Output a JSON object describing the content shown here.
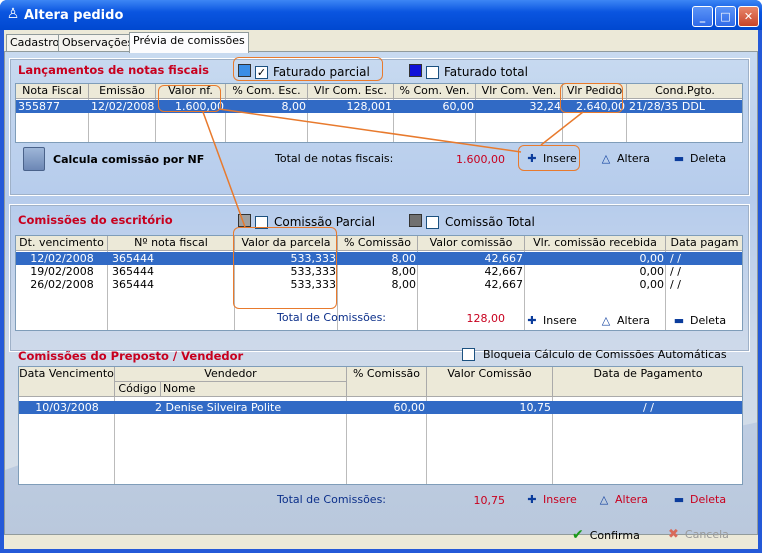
{
  "window": {
    "title": "Altera pedido",
    "min": "_",
    "max": "□",
    "close": "✕"
  },
  "tabs": [
    "Cadastro",
    "Observações",
    "Prévia de comissões"
  ],
  "nf": {
    "title": "Lançamentos de notas fiscais",
    "chk_parcial": "Faturado parcial",
    "chk_total": "Faturado total",
    "headers": [
      "Nota Fiscal",
      "Emissão",
      "Valor nf.",
      "% Com. Esc.",
      "Vlr Com. Esc.",
      "% Com. Ven.",
      "Vlr Com. Ven.",
      "Vlr Pedido",
      "Cond.Pgto."
    ],
    "rows": [
      [
        "355877",
        "12/02/2008",
        "1.600,00",
        "8,00",
        "128,001",
        "60,00",
        "32,24",
        "2.640,00",
        "21/28/35 DDL"
      ]
    ],
    "calc_label": "Calcula comissão por NF",
    "total_label": "Total de notas fiscais:",
    "total_value": "1.600,00",
    "insere": "Insere",
    "altera": "Altera",
    "deleta": "Deleta"
  },
  "esc": {
    "title": "Comissões do escritório",
    "chk_parcial": "Comissão Parcial",
    "chk_total": "Comissão Total",
    "headers": [
      "Dt. vencimento",
      "Nº nota fiscal",
      "Valor da parcela",
      "% Comissão",
      "Valor comissão",
      "Vlr. comissão recebida",
      "Data pagam"
    ],
    "rows": [
      [
        "12/02/2008",
        "365444",
        "533,333",
        "8,00",
        "42,667",
        "0,00",
        " /  /"
      ],
      [
        "19/02/2008",
        "365444",
        "533,333",
        "8,00",
        "42,667",
        "0,00",
        " /  /"
      ],
      [
        "26/02/2008",
        "365444",
        "533,333",
        "8,00",
        "42,667",
        "0,00",
        " /  /"
      ]
    ],
    "total_label": "Total de Comissões:",
    "total_value": "128,00",
    "insere": "Insere",
    "altera": "Altera",
    "deleta": "Deleta"
  },
  "vend": {
    "title": "Comissões do Preposto / Vendedor",
    "chk_bloqueia": "Bloqueia Cálculo de Comissões Automáticas",
    "h_venc": "Data Vencimento",
    "h_vend": "Vendedor",
    "h_codigo": "Código",
    "h_nome": "Nome",
    "h_pct": "% Comissão",
    "h_valor": "Valor Comissão",
    "h_data": "Data de Pagamento",
    "rows": [
      [
        "10/03/2008",
        "2 Denise Silveira Polite",
        "60,00",
        "10,75",
        "/ /"
      ]
    ],
    "total_label": "Total de Comissões:",
    "total_value": "10,75",
    "insere": "Insere",
    "altera": "Altera",
    "deleta": "Deleta"
  },
  "footer": {
    "confirma": "Confirma",
    "cancela": "Cancela"
  }
}
